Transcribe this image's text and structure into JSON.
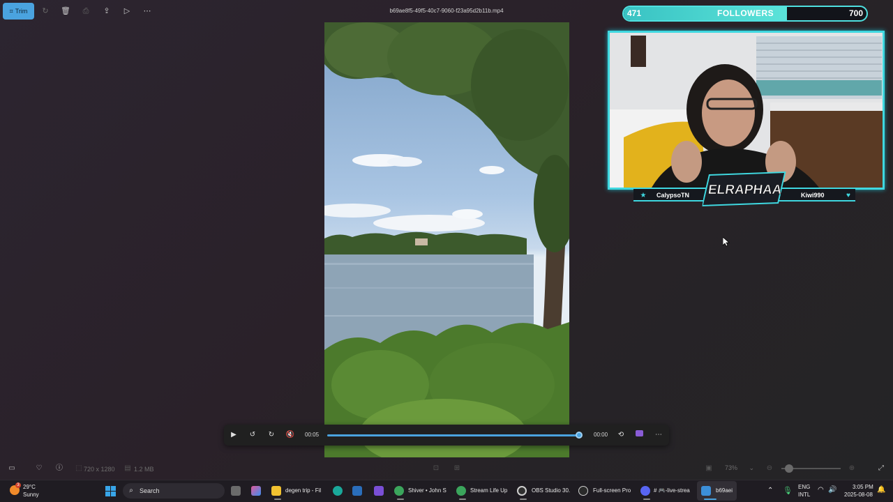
{
  "toolbar": {
    "trim_label": "Trim",
    "file_name": "b69ae8f5-49f5-40c7-9060-f23a95d2b11b.mp4"
  },
  "player": {
    "current_time": "00:05",
    "end_time": "00:00",
    "progress": 0.99
  },
  "statusbar": {
    "resolution": "720 x 1280",
    "file_size": "1.2 MB",
    "zoom": "73%"
  },
  "overlay": {
    "followers_current": "471",
    "followers_label": "FOLLOWERS",
    "followers_goal": "700",
    "followers_progress": 0.673,
    "left_name": "CalypsoTN",
    "right_name": "Kiwi990",
    "logo_text": "ELRAPHAA",
    "accent_color": "#3fd8e0"
  },
  "taskbar": {
    "weather_temp": "29°C",
    "weather_cond": "Sunny",
    "weather_badge": "3",
    "search_label": "Search",
    "apps": [
      {
        "label": "degen trip - Fil"
      },
      {
        "label": "Shiver • John S"
      },
      {
        "label": "Stream Life Up"
      },
      {
        "label": "OBS Studio 30."
      },
      {
        "label": "Full-screen Pro"
      },
      {
        "label": "# 🎮-live-strea"
      },
      {
        "label": "b69aei"
      }
    ],
    "lang_top": "ENG",
    "lang_bottom": "INTL",
    "time": "3:05 PM",
    "date": "2025-08-08"
  }
}
